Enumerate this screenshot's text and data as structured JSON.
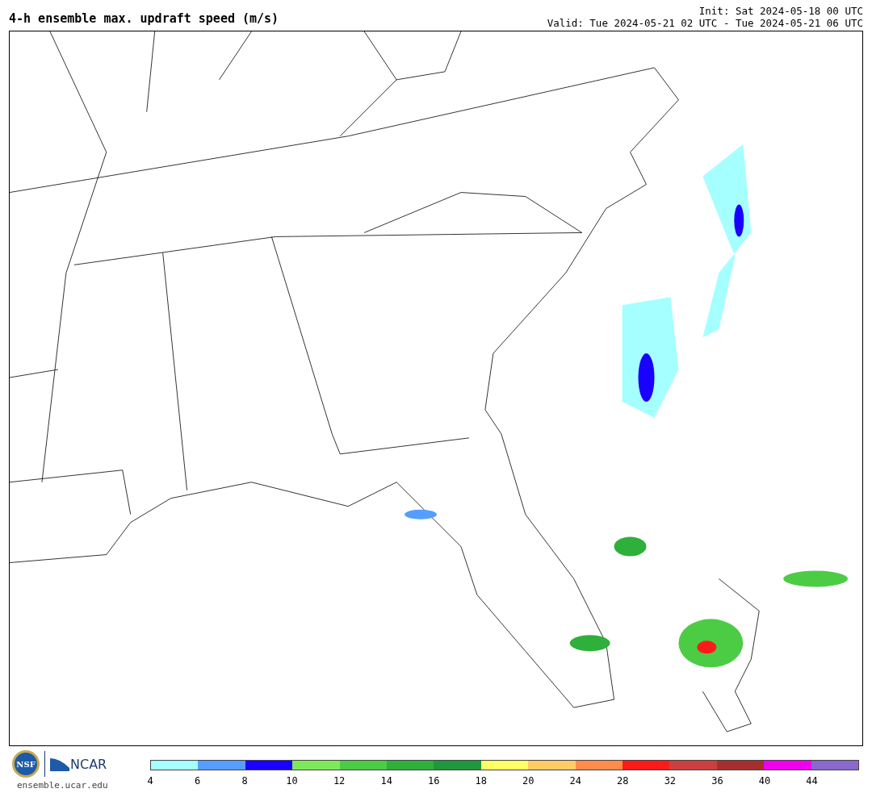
{
  "title": "4-h ensemble max. updraft speed (m/s)",
  "init": "Init: Sat 2024-05-18 00 UTC",
  "valid": "Valid: Tue 2024-05-21 02 UTC - Tue 2024-05-21 06 UTC",
  "logos": {
    "nsf": "NSF",
    "ncar": "NCAR",
    "url": "ensemble.ucar.edu"
  },
  "colorbar": {
    "segments": [
      {
        "color": "#a6ffff"
      },
      {
        "color": "#559eff"
      },
      {
        "color": "#1a00ff"
      },
      {
        "color": "#7ee85b"
      },
      {
        "color": "#4ccc44"
      },
      {
        "color": "#2eb03b"
      },
      {
        "color": "#1f973c"
      },
      {
        "color": "#ffff66"
      },
      {
        "color": "#ffcc66"
      },
      {
        "color": "#ff8c4c"
      },
      {
        "color": "#ff1a1a"
      },
      {
        "color": "#cc3f3f"
      },
      {
        "color": "#a52f2f"
      },
      {
        "color": "#ee00ee"
      },
      {
        "color": "#8b68cc"
      }
    ],
    "ticks": [
      "4",
      "6",
      "8",
      "10",
      "12",
      "14",
      "16",
      "18",
      "20",
      "24",
      "28",
      "32",
      "36",
      "40",
      "44"
    ]
  }
}
